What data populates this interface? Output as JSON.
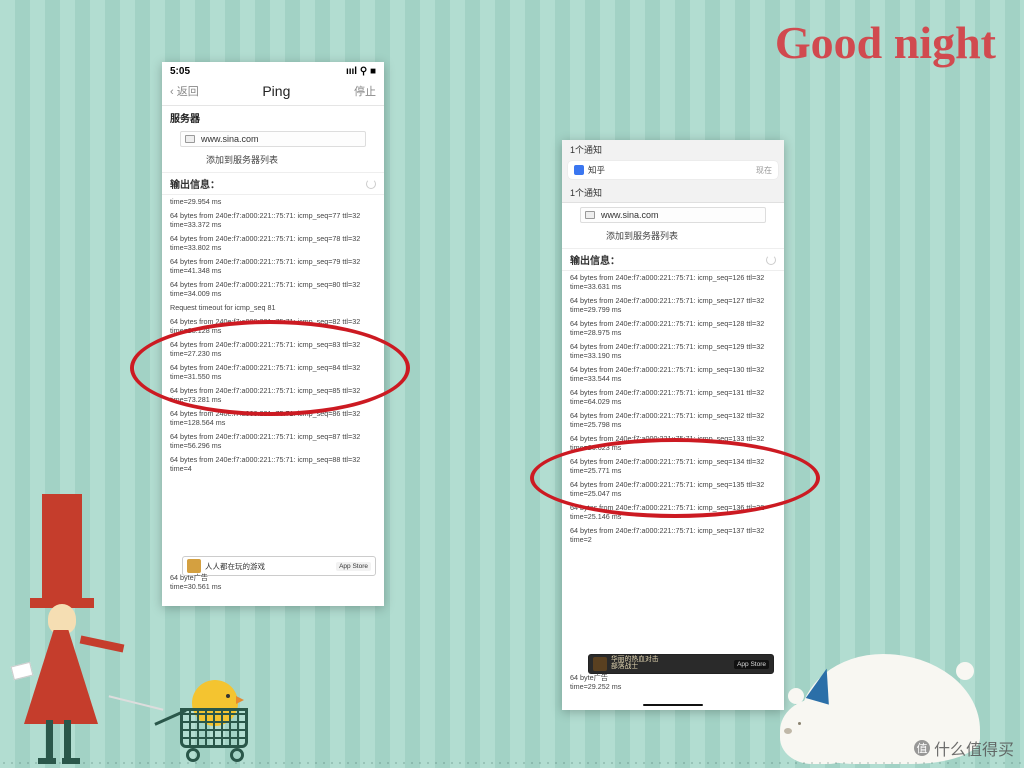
{
  "decor": {
    "goodnight": "Good night",
    "watermark": "什么值得买",
    "watermark_badge": "值"
  },
  "left": {
    "status": {
      "time": "5:05",
      "net": "ıııl ⚲ ■"
    },
    "nav": {
      "back": "‹ 返回",
      "title": "Ping",
      "stop": "停止"
    },
    "server_label": "服务器",
    "server_host": "www.sina.com",
    "add_server": "添加到服务器列表",
    "output_label": "输出信息：",
    "first_time": "time=29.954 ms",
    "entries": [
      {
        "line": "64 bytes from 240e:f7:a000:221::75:71: icmp_seq=77 ttl=32",
        "time": "time=33.372 ms"
      },
      {
        "line": "64 bytes from 240e:f7:a000:221::75:71: icmp_seq=78 ttl=32",
        "time": "time=33.802 ms"
      },
      {
        "line": "64 bytes from 240e:f7:a000:221::75:71: icmp_seq=79 ttl=32",
        "time": "time=41.348 ms"
      },
      {
        "line": "64 bytes from 240e:f7:a000:221::75:71: icmp_seq=80 ttl=32",
        "time": "time=34.009 ms"
      }
    ],
    "timeout": "Request timeout for icmp_seq 81",
    "entries2": [
      {
        "line": "64 bytes from 240e:f7:a000:221::75:71: icmp_seq=82 ttl=32",
        "time": "time=28.128 ms"
      },
      {
        "line": "64 bytes from 240e:f7:a000:221::75:71: icmp_seq=83 ttl=32",
        "time": "time=27.230 ms"
      },
      {
        "line": "64 bytes from 240e:f7:a000:221::75:71: icmp_seq=84 ttl=32",
        "time": "time=31.550 ms"
      },
      {
        "line": "64 bytes from 240e:f7:a000:221::75:71: icmp_seq=85 ttl=32",
        "time": "time=73.281 ms"
      },
      {
        "line": "64 bytes from 240e:f7:a000:221::75:71: icmp_seq=86 ttl=32",
        "time": "time=128.564 ms"
      },
      {
        "line": "64 bytes from 240e:f7:a000:221::75:71: icmp_seq=87 ttl=32",
        "time": "time=56.296 ms"
      },
      {
        "line": "64 bytes from 240e:f7:a000:221::75:71: icmp_seq=88 ttl=32",
        "time": "time=4"
      }
    ],
    "ad": {
      "text": "人人都在玩的游戏",
      "store": " App Store"
    },
    "tail": {
      "line": "64 byte广告",
      "time": "time=30.561 ms"
    }
  },
  "right": {
    "notif": {
      "count1": "1个通知",
      "app": "知乎",
      "when": "现在",
      "count2": "1个通知"
    },
    "server_host": "www.sina.com",
    "add_server": "添加到服务器列表",
    "output_label": "输出信息：",
    "entries": [
      {
        "line": "64 bytes from 240e:f7:a000:221::75:71: icmp_seq=126 ttl=32",
        "time": "time=33.631 ms"
      },
      {
        "line": "64 bytes from 240e:f7:a000:221::75:71: icmp_seq=127 ttl=32",
        "time": "time=29.799 ms"
      },
      {
        "line": "64 bytes from 240e:f7:a000:221::75:71: icmp_seq=128 ttl=32",
        "time": "time=28.975 ms"
      },
      {
        "line": "64 bytes from 240e:f7:a000:221::75:71: icmp_seq=129 ttl=32",
        "time": "time=33.190 ms"
      },
      {
        "line": "64 bytes from 240e:f7:a000:221::75:71: icmp_seq=130 ttl=32",
        "time": "time=33.544 ms"
      },
      {
        "line": "64 bytes from 240e:f7:a000:221::75:71: icmp_seq=131 ttl=32",
        "time": "time=64.029 ms"
      },
      {
        "line": "64 bytes from 240e:f7:a000:221::75:71: icmp_seq=132 ttl=32",
        "time": "time=25.798 ms"
      },
      {
        "line": "64 bytes from 240e:f7:a000:221::75:71: icmp_seq=133 ttl=32",
        "time": "time=26.623 ms"
      },
      {
        "line": "64 bytes from 240e:f7:a000:221::75:71: icmp_seq=134 ttl=32",
        "time": "time=25.771 ms"
      },
      {
        "line": "64 bytes from 240e:f7:a000:221::75:71: icmp_seq=135 ttl=32",
        "time": "time=25.047 ms"
      },
      {
        "line": "64 bytes from 240e:f7:a000:221::75:71: icmp_seq=136 ttl=32",
        "time": "time=25.146 ms"
      },
      {
        "line": "64 bytes from 240e:f7:a000:221::75:71: icmp_seq=137 ttl=32",
        "time": "time=2"
      }
    ],
    "ad": {
      "text": "华丽的热血对击\n部落战士",
      "store": " App Store"
    },
    "tail": {
      "line": "64 byte广告",
      "time": "time=29.252 ms"
    }
  }
}
